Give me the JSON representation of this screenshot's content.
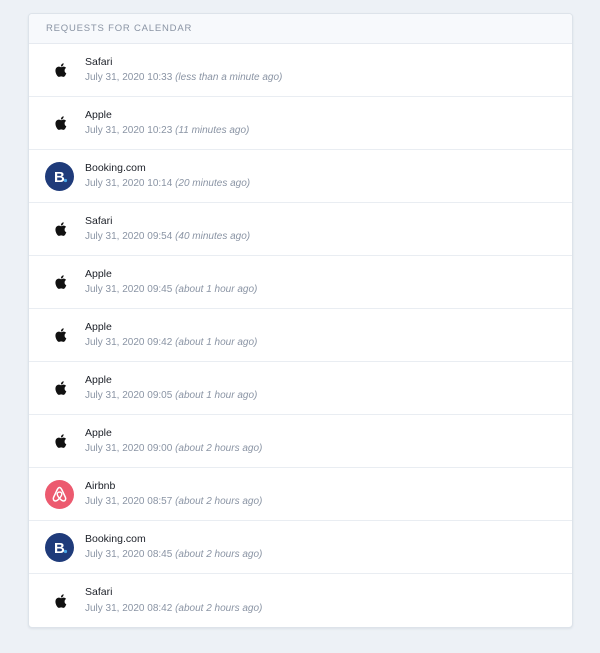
{
  "panel": {
    "title": "Requests for Calendar"
  },
  "requests": [
    {
      "client": "Safari",
      "logo": "apple-icon",
      "date": "July 31, 2020 10:33",
      "ago": "(less than a minute ago)"
    },
    {
      "client": "Apple",
      "logo": "apple-icon",
      "date": "July 31, 2020 10:23",
      "ago": "(11 minutes ago)"
    },
    {
      "client": "Booking.com",
      "logo": "booking-icon",
      "date": "July 31, 2020 10:14",
      "ago": "(20 minutes ago)"
    },
    {
      "client": "Safari",
      "logo": "apple-icon",
      "date": "July 31, 2020 09:54",
      "ago": "(40 minutes ago)"
    },
    {
      "client": "Apple",
      "logo": "apple-icon",
      "date": "July 31, 2020 09:45",
      "ago": "(about 1 hour ago)"
    },
    {
      "client": "Apple",
      "logo": "apple-icon",
      "date": "July 31, 2020 09:42",
      "ago": "(about 1 hour ago)"
    },
    {
      "client": "Apple",
      "logo": "apple-icon",
      "date": "July 31, 2020 09:05",
      "ago": "(about 1 hour ago)"
    },
    {
      "client": "Apple",
      "logo": "apple-icon",
      "date": "July 31, 2020 09:00",
      "ago": "(about 2 hours ago)"
    },
    {
      "client": "Airbnb",
      "logo": "airbnb-icon",
      "date": "July 31, 2020 08:57",
      "ago": "(about 2 hours ago)"
    },
    {
      "client": "Booking.com",
      "logo": "booking-icon",
      "date": "July 31, 2020 08:45",
      "ago": "(about 2 hours ago)"
    },
    {
      "client": "Safari",
      "logo": "apple-icon",
      "date": "July 31, 2020 08:42",
      "ago": "(about 2 hours ago)"
    }
  ],
  "colors": {
    "page_background": "#edf1f6",
    "booking_brand": "#1f3b7a",
    "airbnb_brand": "#ec5a6f",
    "muted_text": "#8a94a4"
  }
}
